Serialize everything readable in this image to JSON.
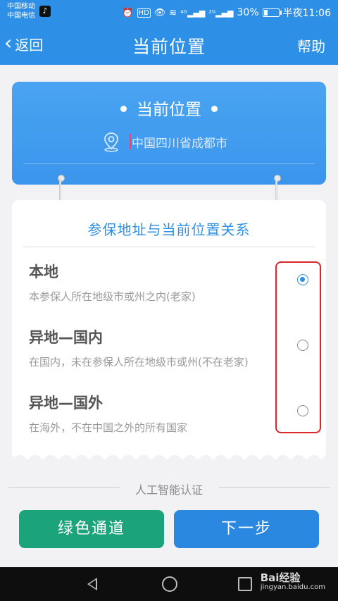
{
  "status_bar": {
    "carrier_1": "中国移动",
    "carrier_2": "中国电信",
    "battery_percent": "30%",
    "battery_level": 0.3,
    "time": "半夜11:06"
  },
  "nav": {
    "back_label": "返回",
    "title": "当前位置",
    "help_label": "帮助"
  },
  "location_card": {
    "title": "当前位置",
    "location_text": "中国四川省成都市"
  },
  "relation_card": {
    "title": "参保地址与当前位置关系",
    "options": [
      {
        "title": "本地",
        "desc": "本参保人所在地级市或州之内(老家)",
        "selected": true
      },
      {
        "title": "异地—国内",
        "desc": "在国内，未在参保人所在地级市或州(不在老家)",
        "selected": false
      },
      {
        "title": "异地—国外",
        "desc": "在海外，不在中国之外的所有国家",
        "selected": false
      }
    ]
  },
  "footer": {
    "divider_text": "人工智能认证",
    "green_button": "绿色通道",
    "next_button": "下一步"
  },
  "watermark": {
    "brand": "Bai经验",
    "url": "jingyan.baidu.com"
  },
  "colors": {
    "primary_blue": "#2e8fe6",
    "green": "#1ba37b",
    "highlight_red": "#d9262c"
  }
}
